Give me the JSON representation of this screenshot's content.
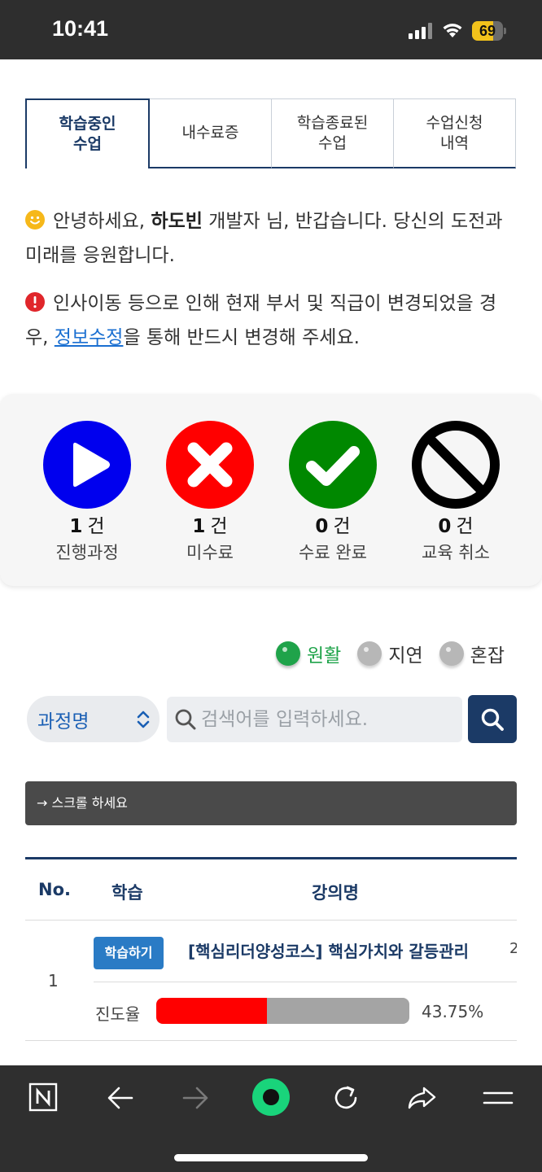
{
  "status_bar": {
    "time": "10:41",
    "battery_level": "69",
    "battery_fraction": 0.69
  },
  "tabs": [
    {
      "label": "학습중인\n수업",
      "active": true
    },
    {
      "label": "내수료증",
      "active": false
    },
    {
      "label": "학습종료된\n수업",
      "active": false
    },
    {
      "label": "수업신청\n내역",
      "active": false
    }
  ],
  "greeting": {
    "prefix": "안녕하세요, ",
    "name": "하도빈",
    "suffix": " 개발자 님, 반갑습니다. 당신의 도전과 미래를 응원합니다."
  },
  "notice": {
    "prefix": "인사이동 등으로 인해 현재 부서 및 직급이 변경되었을 경우, ",
    "link": "정보수정",
    "suffix": "을 통해 반드시 변경해 주세요."
  },
  "summary": [
    {
      "icon": "play-icon",
      "count": "1",
      "unit": "건",
      "label": "진행과정",
      "color": "#0000ee"
    },
    {
      "icon": "x-icon",
      "count": "1",
      "unit": "건",
      "label": "미수료",
      "color": "#ff0000"
    },
    {
      "icon": "check-icon",
      "count": "0",
      "unit": "건",
      "label": "수료 완료",
      "color": "#008800"
    },
    {
      "icon": "prohibited-icon",
      "count": "0",
      "unit": "건",
      "label": "교육 취소",
      "color": "#000000"
    }
  ],
  "legend": [
    {
      "label": "원활",
      "color": "#1fa34a"
    },
    {
      "label": "지연",
      "color": "#b7b7b7"
    },
    {
      "label": "혼잡",
      "color": "#b7b7b7"
    }
  ],
  "search": {
    "select_value": "과정명",
    "placeholder": "검색어를 입력하세요.",
    "button_icon": "search-icon"
  },
  "scroll_hint": "→ 스크롤 하세요",
  "table": {
    "headers": {
      "no": "No.",
      "study": "학습",
      "course": "강의명"
    },
    "rows": [
      {
        "no": "1",
        "study_button": "학습하기",
        "title": "[핵심리더양성코스] 핵심가치와 갈등관리",
        "overflow": "2",
        "progress_label": "진도율",
        "progress_text": "43.75%",
        "progress_value": 0.4375
      }
    ]
  },
  "bottom_bar": {
    "icons": [
      "naver-icon",
      "back-arrow-icon",
      "forward-arrow-icon",
      "home-circle-icon",
      "reload-icon",
      "share-icon",
      "menu-icon"
    ],
    "accent": "#19d47b"
  }
}
